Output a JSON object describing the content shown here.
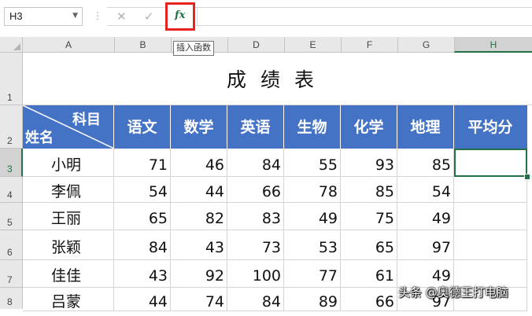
{
  "formula_bar": {
    "name_box": "H3",
    "cancel_icon": "✕",
    "enter_icon": "✓",
    "fx_icon": "fx",
    "formula_value": "",
    "tooltip": "插入函数"
  },
  "columns": [
    "A",
    "B",
    "C",
    "D",
    "E",
    "F",
    "G",
    "H"
  ],
  "rows": [
    "1",
    "2",
    "3",
    "4",
    "5",
    "6",
    "7",
    "8"
  ],
  "sheet": {
    "title": "成绩表",
    "header_diag_top": "科目",
    "header_diag_bottom": "姓名",
    "subjects": [
      "语文",
      "数学",
      "英语",
      "生物",
      "化学",
      "地理",
      "平均分"
    ],
    "students": [
      {
        "name": "小明",
        "scores": [
          "71",
          "46",
          "84",
          "55",
          "93",
          "85"
        ],
        "avg": ""
      },
      {
        "name": "李佩",
        "scores": [
          "54",
          "44",
          "66",
          "78",
          "85",
          "54"
        ],
        "avg": ""
      },
      {
        "name": "王丽",
        "scores": [
          "65",
          "82",
          "83",
          "49",
          "75",
          "49"
        ],
        "avg": ""
      },
      {
        "name": "张颖",
        "scores": [
          "84",
          "43",
          "73",
          "53",
          "65",
          "97"
        ],
        "avg": ""
      },
      {
        "name": "佳佳",
        "scores": [
          "43",
          "92",
          "100",
          "77",
          "61",
          "49"
        ],
        "avg": ""
      },
      {
        "name": "吕蒙",
        "scores": [
          "44",
          "74",
          "84",
          "89",
          "66",
          "97"
        ],
        "avg": ""
      }
    ]
  },
  "colors": {
    "header_fill": "#4472c4",
    "selection": "#217346",
    "highlight_box": "#e8221c"
  },
  "watermark": "头条 @奥德王打电脑"
}
